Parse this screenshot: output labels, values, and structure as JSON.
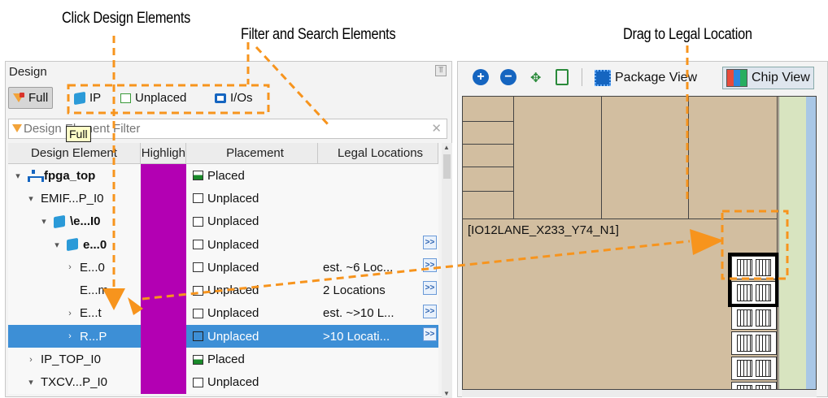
{
  "callouts": {
    "click": "Click Design Elements",
    "filter": "Filter and Search Elements",
    "drag": "Drag to Legal Location"
  },
  "design_panel": {
    "title": "Design",
    "pin": "⫪",
    "toolbar": [
      {
        "label": "Full",
        "icon": "full-filter-icon",
        "pressed": true
      },
      {
        "label": "IP",
        "icon": "ip-cube-icon"
      },
      {
        "label": "Unplaced",
        "icon": "unplaced-square-icon"
      },
      {
        "label": "I/Os",
        "icon": "io-icon"
      }
    ],
    "filter_placeholder": "Design Element Filter",
    "tooltip": "Full",
    "columns": [
      "Design Element",
      "Highligh",
      "Placement",
      "Legal Locations"
    ],
    "rows": [
      {
        "name": "fpga_top",
        "expander": "▾",
        "indent": 0,
        "icon": "hierarchy-icon",
        "bold": true,
        "placement": "Placed",
        "legal": "",
        "more": false
      },
      {
        "name": "EMIF...P_I0",
        "expander": "▾",
        "indent": 1,
        "icon": "",
        "bold": false,
        "placement": "Unplaced",
        "legal": "",
        "more": false
      },
      {
        "name": "\\e...I0",
        "expander": "▾",
        "indent": 2,
        "icon": "ip-cube-icon",
        "bold": true,
        "placement": "Unplaced",
        "legal": "",
        "more": false
      },
      {
        "name": "e...0",
        "expander": "▾",
        "indent": 3,
        "icon": "ip-cube-icon",
        "bold": true,
        "placement": "Unplaced",
        "legal": "",
        "more": true
      },
      {
        "name": "E...0",
        "expander": "›",
        "indent": 4,
        "icon": "",
        "bold": false,
        "placement": "Unplaced",
        "legal": "est. ~6 Loc...",
        "more": true
      },
      {
        "name": "E...m",
        "expander": "",
        "indent": 4,
        "icon": "",
        "bold": false,
        "placement": "Unplaced",
        "legal": "2 Locations",
        "more": true
      },
      {
        "name": "E...t",
        "expander": "›",
        "indent": 4,
        "icon": "",
        "bold": false,
        "placement": "Unplaced",
        "legal": "est. ~>10 L...",
        "more": true
      },
      {
        "name": "R...P",
        "expander": "›",
        "indent": 4,
        "icon": "",
        "bold": false,
        "placement": "Unplaced",
        "legal": ">10 Locati...",
        "more": true,
        "selected": true
      },
      {
        "name": "IP_TOP_I0",
        "expander": "›",
        "indent": 1,
        "icon": "",
        "bold": false,
        "placement": "Placed",
        "legal": "",
        "more": false
      },
      {
        "name": "TXCV...P_I0",
        "expander": "▾",
        "indent": 1,
        "icon": "",
        "bold": false,
        "placement": "Unplaced",
        "legal": "",
        "more": false
      }
    ],
    "more_label": ">>"
  },
  "chip_panel": {
    "zoom_in": "+",
    "zoom_out": "−",
    "package_view": "Package View",
    "chip_view": "Chip View",
    "io_label": "[IO12LANE_X233_Y74_N1]"
  },
  "colors": {
    "highlight": "#b300b3",
    "accent": "#f7941d",
    "selected_row": "#3d8fd6",
    "chip_bg": "#d2bea0"
  }
}
